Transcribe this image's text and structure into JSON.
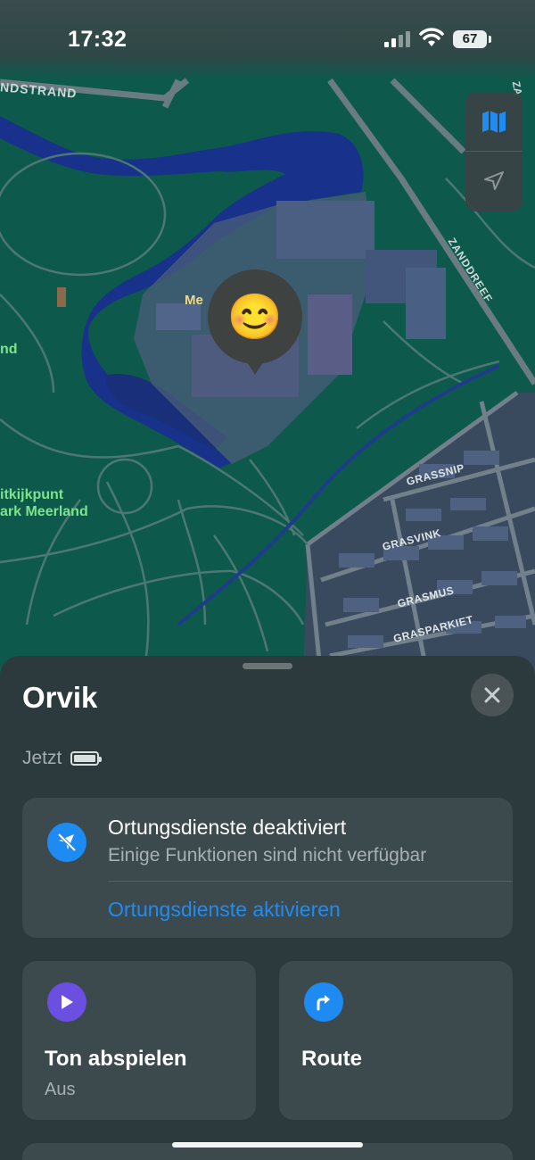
{
  "status_bar": {
    "time": "17:32",
    "battery": "67"
  },
  "map": {
    "labels": {
      "street_top_left": "NDSTRAND",
      "poi_partial": "Me",
      "park_left": "nd",
      "viewpoint_line1": "itkijkpunt",
      "viewpoint_line2": "ark Meerland",
      "zanddreef": "ZANDDREEF",
      "top_right_partial": "ZA",
      "grassnip": "GRASSNIP",
      "grasvink": "GRASVINK",
      "grasmus": "GRASMUS",
      "grasparkiet": "GRASPARKIET"
    },
    "controls": {
      "map_mode_icon": "map-icon",
      "location_icon": "location-arrow-icon"
    },
    "pin_emoji": "😊"
  },
  "sheet": {
    "title": "Orvik",
    "updated": "Jetzt",
    "location_card": {
      "heading": "Ortungsdienste deaktiviert",
      "subtitle": "Einige Funktionen sind nicht verfügbar",
      "action": "Ortungsdienste aktivieren"
    },
    "tiles": [
      {
        "label": "Ton abspielen",
        "sublabel": "Aus",
        "icon": "play-icon",
        "color": "#6a4fe0"
      },
      {
        "label": "Route",
        "icon": "turn-right-arrow-icon",
        "color": "#1d8bf1"
      }
    ]
  },
  "colors": {
    "accent": "#1f8cf3",
    "map_green": "#0d5a4c",
    "water": "#18318a"
  }
}
